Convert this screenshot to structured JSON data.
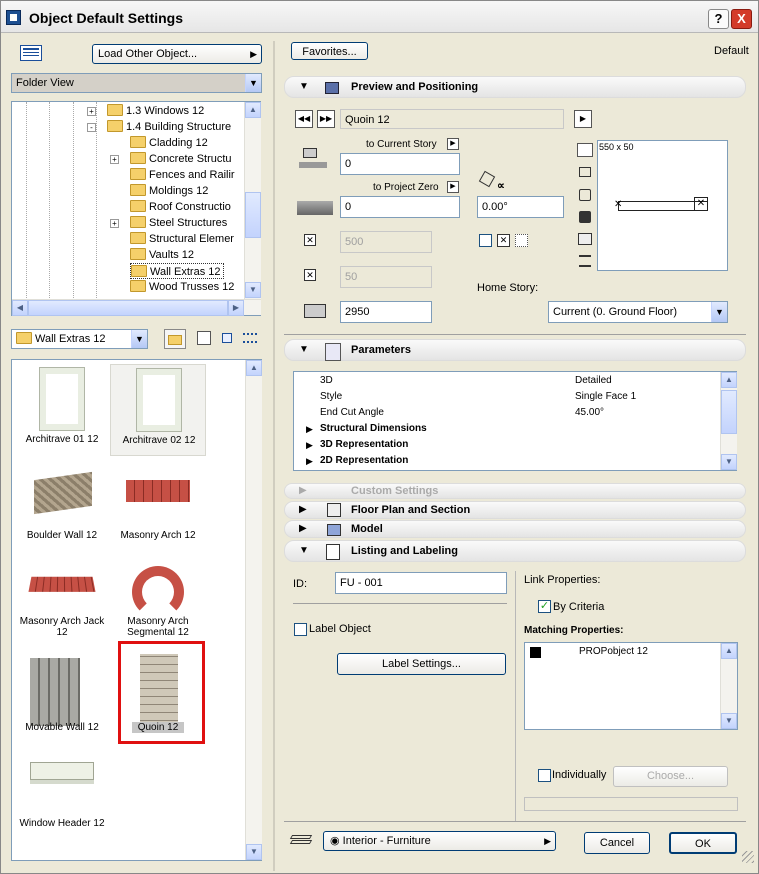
{
  "window": {
    "title": "Object Default Settings",
    "help": "?",
    "close": "X"
  },
  "left": {
    "load_other": "Load Other Object...",
    "folder_view": "Folder View",
    "tree": [
      {
        "label": "1.3 Windows 12",
        "pm": "+"
      },
      {
        "label": "1.4 Building Structure",
        "pm": "-"
      },
      {
        "label": "Cladding 12",
        "pm": ""
      },
      {
        "label": "Concrete Structu",
        "pm": "+"
      },
      {
        "label": "Fences and Railir",
        "pm": ""
      },
      {
        "label": "Moldings 12",
        "pm": ""
      },
      {
        "label": "Roof Constructio",
        "pm": ""
      },
      {
        "label": "Steel Structures",
        "pm": "+"
      },
      {
        "label": "Structural Elemer",
        "pm": ""
      },
      {
        "label": "Vaults 12",
        "pm": ""
      },
      {
        "label": "Wall Extras 12",
        "pm": ""
      },
      {
        "label": "Wood Trusses 12",
        "pm": ""
      }
    ],
    "current_folder": "Wall Extras 12",
    "gallery": [
      {
        "label": "Architrave 01 12",
        "icon": "architrave-thumb"
      },
      {
        "label": "Architrave 02 12",
        "icon": "architrave-thumb"
      },
      {
        "label": "Boulder Wall 12",
        "icon": "boulder-wall-thumb"
      },
      {
        "label": "Masonry Arch 12",
        "icon": "masonry-arch-thumb"
      },
      {
        "label": "Masonry Arch Jack 12",
        "icon": "masonry-arch-jack-thumb"
      },
      {
        "label": "Masonry Arch Segmental 12",
        "icon": "masonry-arch-segmental-thumb"
      },
      {
        "label": "Movable Wall 12",
        "icon": "movable-wall-thumb"
      },
      {
        "label": "Quoin 12",
        "icon": "quoin-thumb"
      },
      {
        "label": "Window Header 12",
        "icon": "window-header-thumb"
      }
    ],
    "highlight_color": "#e01010"
  },
  "right": {
    "favorites": "Favorites...",
    "default_label": "Default",
    "preview": {
      "title": "Preview and Positioning",
      "object_name": "Quoin 12",
      "to_current_story": "to Current Story",
      "current_story_value": "0",
      "to_project_zero": "to Project Zero",
      "project_zero_value": "0",
      "angle": "0.00°",
      "width": "500",
      "depth": "50",
      "height": "2950",
      "home_story_label": "Home Story:",
      "home_story_value": "Current (0. Ground Floor)",
      "preview_dims": "550 x 50"
    },
    "parameters": {
      "title": "Parameters",
      "rows": [
        {
          "name": "3D",
          "value": "Detailed",
          "bold": false,
          "group": false
        },
        {
          "name": "Style",
          "value": "Single Face 1",
          "bold": false,
          "group": false
        },
        {
          "name": "End Cut Angle",
          "value": "45.00°",
          "bold": false,
          "group": false
        },
        {
          "name": "Structural Dimensions",
          "value": "",
          "bold": true,
          "group": true
        },
        {
          "name": "3D Representation",
          "value": "",
          "bold": true,
          "group": true
        },
        {
          "name": "2D Representation",
          "value": "",
          "bold": true,
          "group": true
        }
      ]
    },
    "custom_settings": "Custom Settings",
    "floor_plan": "Floor Plan and Section",
    "model": "Model",
    "listing": {
      "title": "Listing and Labeling",
      "id_label": "ID:",
      "id_value": "FU - 001",
      "label_object": "Label Object",
      "label_settings": "Label Settings...",
      "link_properties": "Link Properties:",
      "by_criteria": "By Criteria",
      "matching_properties": "Matching Properties:",
      "matching_item": "PROPobject 12",
      "individually": "Individually",
      "choose": "Choose..."
    },
    "layer": "Interior - Furniture",
    "cancel": "Cancel",
    "ok": "OK"
  }
}
